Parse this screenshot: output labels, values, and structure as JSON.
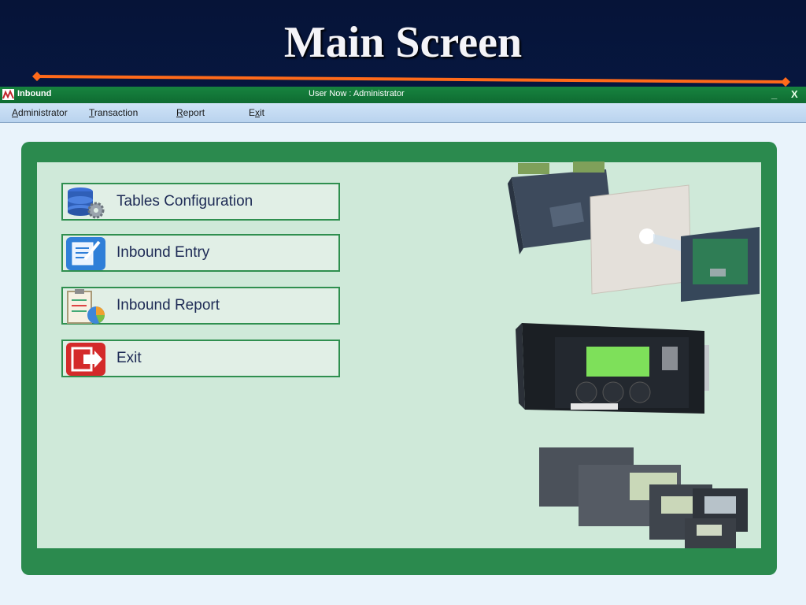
{
  "slide": {
    "title": "Main Screen"
  },
  "window": {
    "app_title": "Inbound",
    "user_now": "User Now : Administrator",
    "minimize_label": "_",
    "close_label": "X"
  },
  "menu": [
    {
      "label": "Administrator",
      "mnemonic": "A",
      "rest": "dministrator"
    },
    {
      "label": "Transaction",
      "mnemonic": "T",
      "rest": "ransaction"
    },
    {
      "label": "Report",
      "mnemonic": "R",
      "rest": "eport"
    },
    {
      "label": "Exit",
      "pre": "E",
      "mnemonic": "x",
      "rest": "it"
    }
  ],
  "buttons": [
    {
      "label": "Tables Configuration",
      "icon": "database-gear-icon"
    },
    {
      "label": "Inbound Entry",
      "icon": "notepad-pencil-icon"
    },
    {
      "label": "Inbound Report",
      "icon": "clipboard-chart-icon"
    },
    {
      "label": "Exit",
      "icon": "exit-door-icon"
    }
  ],
  "colors": {
    "titlebar": "#17843f",
    "frame": "#2b8a4e",
    "panel": "#cfe9d9",
    "button_text": "#1d2a55",
    "accent_line": "#ff6a1a"
  }
}
